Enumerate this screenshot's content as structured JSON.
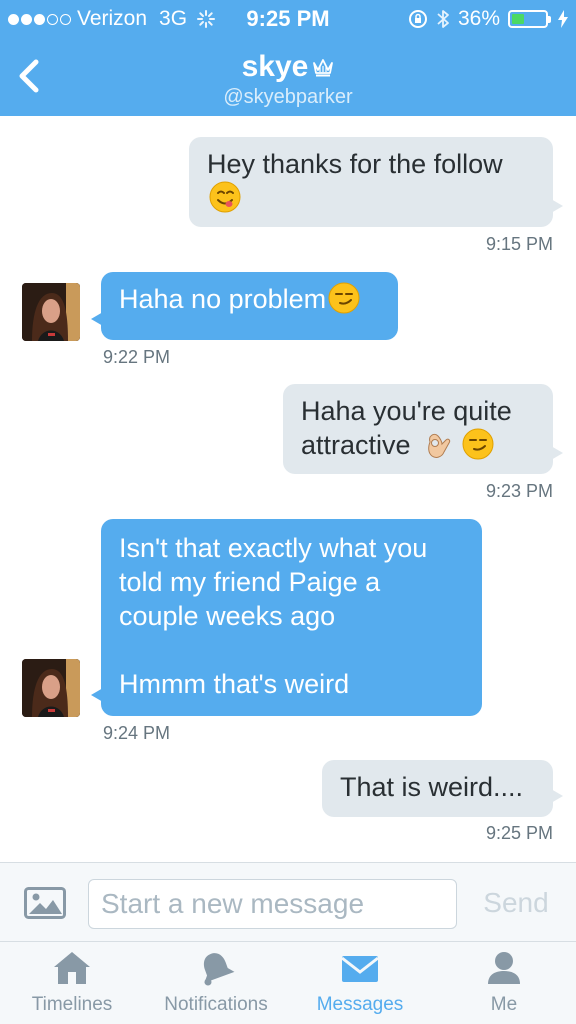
{
  "status_bar": {
    "carrier": "Verizon",
    "network": "3G",
    "time": "9:25 PM",
    "battery": "36%",
    "battery_level": 0.36,
    "signal_bars": 3
  },
  "header": {
    "title": "skye",
    "handle": "@skyebparker",
    "back_icon": "chevron-left-icon",
    "title_badge_icon": "crown-icon"
  },
  "messages": [
    {
      "direction": "outgoing",
      "text": "Hey thanks for the follow",
      "emoji": [
        "yum-face"
      ],
      "time": "9:15 PM"
    },
    {
      "direction": "incoming",
      "text": "Haha no problem",
      "emoji": [
        "smirk-face"
      ],
      "time": "9:22 PM"
    },
    {
      "direction": "outgoing",
      "lines": [
        "Haha you're quite",
        "attractive"
      ],
      "emoji": [
        "ok-hand",
        "smirk-face"
      ],
      "time": "9:23 PM"
    },
    {
      "direction": "incoming",
      "lines": [
        "Isn't that exactly what you",
        "told my friend Paige a",
        "couple weeks ago",
        "",
        "Hmmm that's weird"
      ],
      "time": "9:24 PM"
    },
    {
      "direction": "outgoing",
      "text": "That is weird....",
      "time": "9:25 PM"
    }
  ],
  "composer": {
    "placeholder": "Start a new message",
    "send_label": "Send",
    "photo_icon": "image-icon"
  },
  "tabs": [
    {
      "label": "Timelines",
      "icon": "home-icon",
      "active": false
    },
    {
      "label": "Notifications",
      "icon": "bell-icon",
      "active": false
    },
    {
      "label": "Messages",
      "icon": "envelope-icon",
      "active": true
    },
    {
      "label": "Me",
      "icon": "person-icon",
      "active": false
    }
  ],
  "colors": {
    "accent": "#55acee",
    "outgoing_bubble": "#e1e8ed",
    "incoming_bubble": "#55acee",
    "battery_green": "#4cd964"
  }
}
